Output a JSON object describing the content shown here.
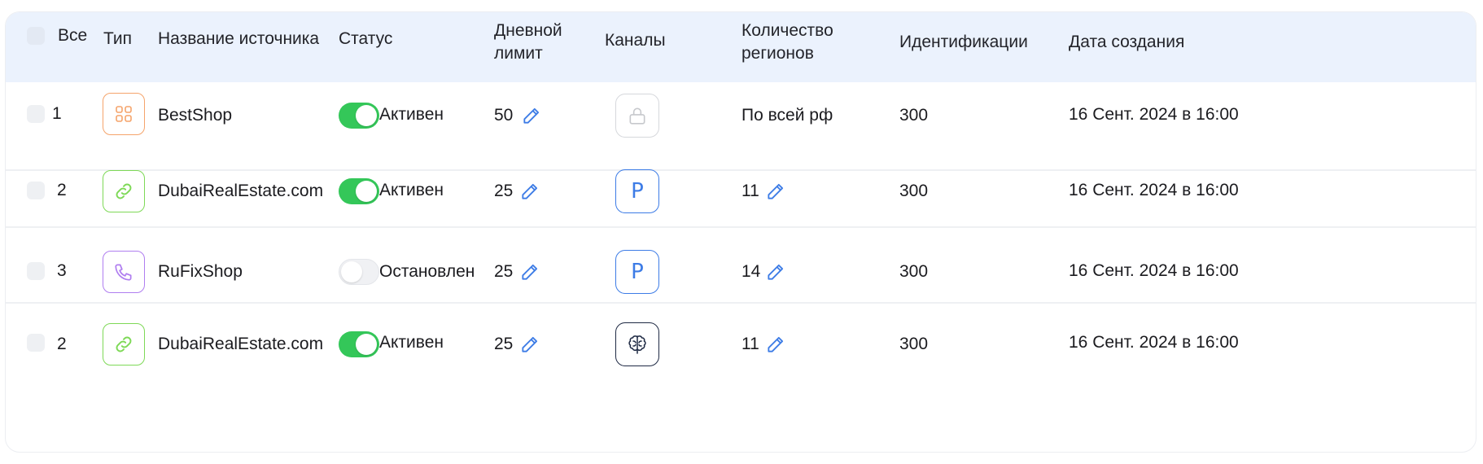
{
  "columns": {
    "all": "Все",
    "type": "Тип",
    "source_name": "Название источника",
    "status": "Статус",
    "daily_limit": "Дневной лимит",
    "channels": "Каналы",
    "regions_count": "Количество регионов",
    "identifications": "Идентификации",
    "created_at": "Дата создания"
  },
  "rows": [
    {
      "num": "1",
      "type_icon": "grid-icon",
      "name": "BestShop",
      "status_on": true,
      "status": "Активен",
      "limit": "50",
      "channel_icon": "lock-icon",
      "regions": "По всей рф",
      "regions_editable": false,
      "ident": "300",
      "date": "16 Сент. 2024 в 16:00"
    },
    {
      "num": "2",
      "type_icon": "link-icon",
      "name": "DubaiRealEstate.com",
      "status_on": true,
      "status": "Активен",
      "limit": "25",
      "channel_icon": "p-letter-icon",
      "channel_text": "P",
      "regions": "11",
      "regions_editable": true,
      "ident": "300",
      "date": "16 Сент. 2024 в 16:00"
    },
    {
      "num": "3",
      "type_icon": "phone-icon",
      "name": "RuFixShop",
      "status_on": false,
      "status": "Остановлен",
      "limit": "25",
      "channel_icon": "p-letter-icon",
      "channel_text": "P",
      "regions": "14",
      "regions_editable": true,
      "ident": "300",
      "date": "16 Сент. 2024 в 16:00"
    },
    {
      "num": "2",
      "type_icon": "link-icon",
      "name": "DubaiRealEstate.com",
      "status_on": true,
      "status": "Активен",
      "limit": "25",
      "channel_icon": "brain-icon",
      "regions": "11",
      "regions_editable": true,
      "ident": "300",
      "date": "16 Сент. 2024 в 16:00"
    }
  ],
  "colors": {
    "header_bg": "#ebf2fd",
    "toggle_on": "#34c759",
    "accent_blue": "#3d7ce6",
    "type_orange": "#f5a46b",
    "type_green": "#7ed957",
    "type_purple": "#b07ef0"
  }
}
